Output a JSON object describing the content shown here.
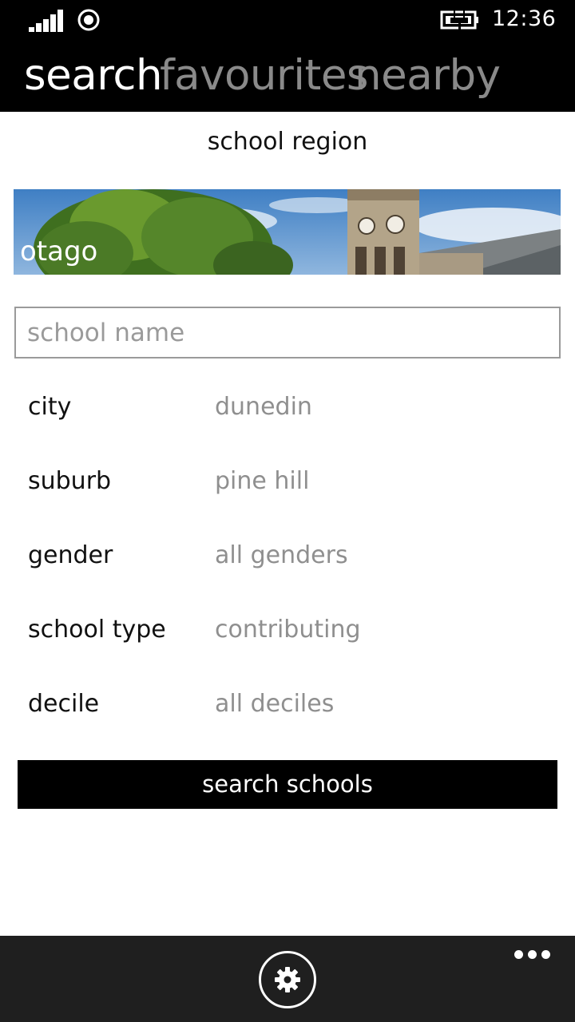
{
  "status_bar": {
    "time": "12:36",
    "icons": [
      "signal-strength-icon",
      "wifi-icon",
      "battery-charging-icon"
    ]
  },
  "pivot": {
    "tabs": [
      {
        "label": "search",
        "active": true
      },
      {
        "label": "favourites",
        "active": false
      },
      {
        "label": "nearby",
        "active": false
      }
    ]
  },
  "region": {
    "title": "school region",
    "selected": "otago"
  },
  "search": {
    "name_placeholder": "school name",
    "name_value": ""
  },
  "fields": [
    {
      "label": "city",
      "value": "dunedin"
    },
    {
      "label": "suburb",
      "value": "pine hill"
    },
    {
      "label": "gender",
      "value": "all genders"
    },
    {
      "label": "school type",
      "value": "contributing"
    },
    {
      "label": "decile",
      "value": "all deciles"
    }
  ],
  "actions": {
    "search_label": "search schools"
  },
  "app_bar": {
    "icons": [
      "settings-icon",
      "more-options-icon"
    ]
  },
  "colors": {
    "chrome": "#000000",
    "app_bar": "#1f1f1f",
    "inactive_tab": "#8a8a8a",
    "value_text": "#8f8f8f"
  }
}
